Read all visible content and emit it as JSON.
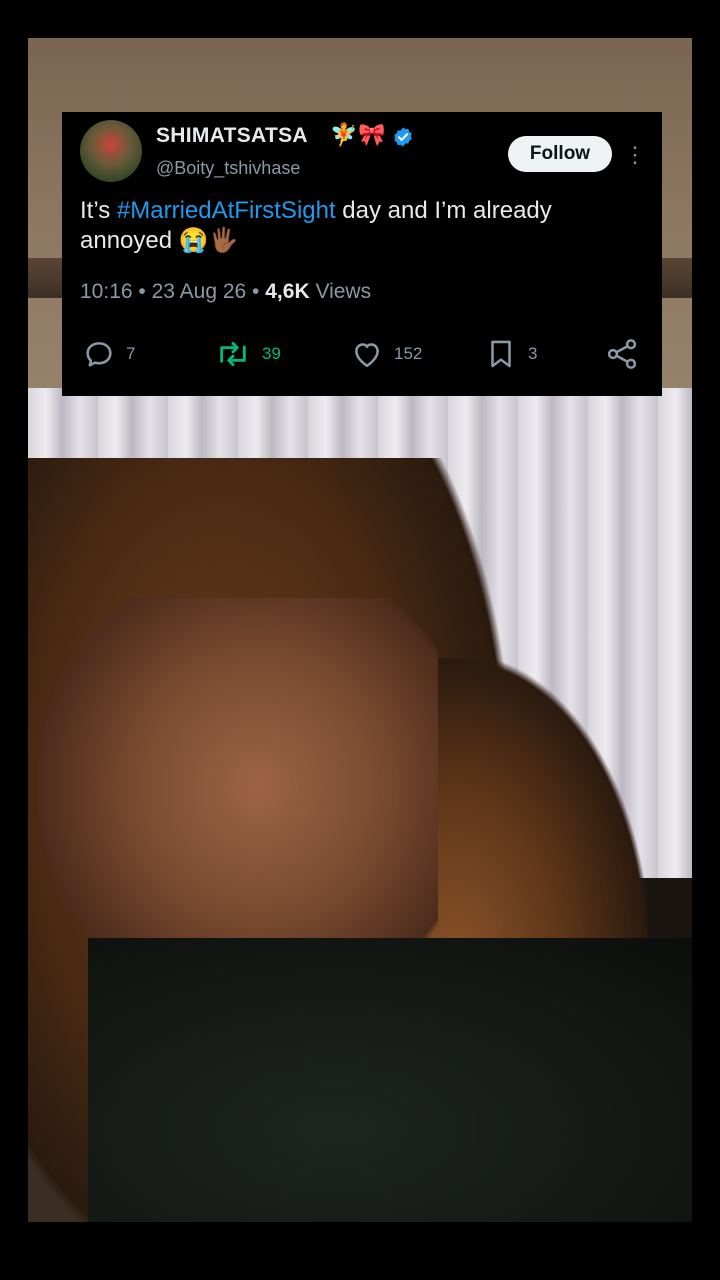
{
  "tweet": {
    "display_name": "SHIMATSATSA",
    "name_emojis": [
      "🧚",
      "🎀"
    ],
    "handle": "@Boity_tshivhase",
    "follow_label": "Follow",
    "text_prefix": "It’s ",
    "hashtag": "#MarriedAtFirstSight",
    "text_suffix": " day and I’m already annoyed 😭🖐🏾",
    "time": "10:16",
    "date": "23 Aug 26",
    "views_count": "4,6K",
    "views_label": "Views",
    "separator": "•",
    "replies": "7",
    "retweets": "39",
    "likes": "152",
    "bookmarks": "3"
  },
  "colors": {
    "link": "#1d9bf0",
    "retweet": "#00ba7c",
    "muted": "#8b98a5",
    "text": "#e7e9ea",
    "verified": "#1d9bf0"
  },
  "icons": [
    "verified-badge-icon",
    "more-icon",
    "reply-icon",
    "retweet-icon",
    "like-icon",
    "bookmark-icon",
    "share-icon"
  ]
}
